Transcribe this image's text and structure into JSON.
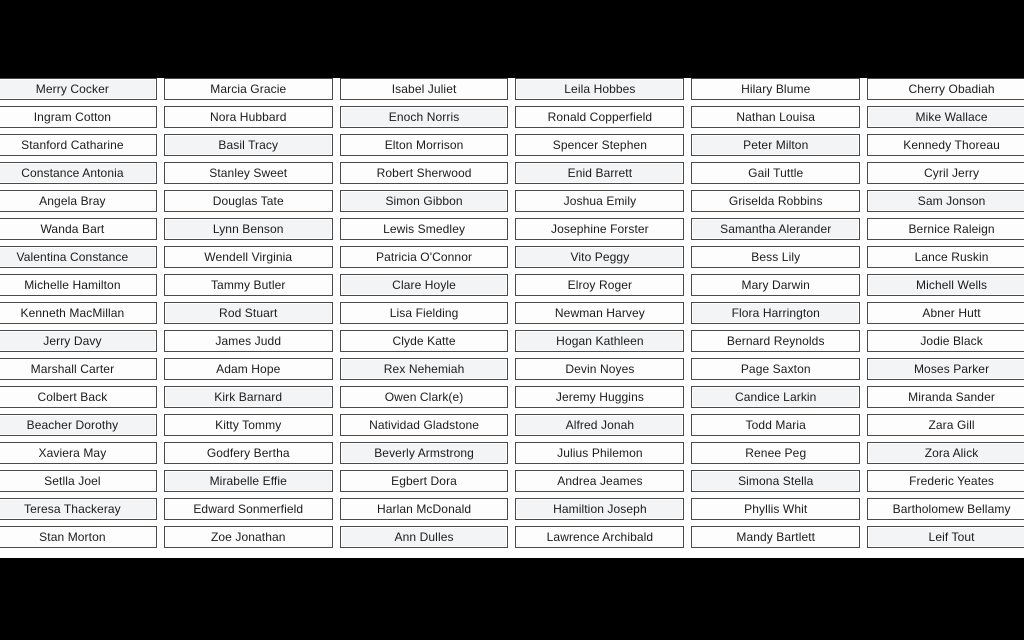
{
  "screen": {
    "background_color": "#000000",
    "content_background_color": "#ffffff",
    "cell_border_color": "#4a4a4a",
    "cell_text_color": "#1a1a1a",
    "columns": 6,
    "rows": 17
  },
  "grid": {
    "description": "Six-column grid of clickable person name buttons",
    "column_headers": [],
    "columns": [
      {
        "index": 1,
        "names": [
          "Merry Cocker",
          "Ingram Cotton",
          "Stanford Catharine",
          "Constance Antonia",
          "Angela Bray",
          "Wanda Bart",
          "Valentina Constance",
          "Michelle Hamilton",
          "Kenneth MacMillan",
          "Jerry Davy",
          "Marshall Carter",
          "Colbert Back",
          "Beacher Dorothy",
          "Xaviera May",
          "Setlla Joel",
          "Teresa Thackeray",
          "Stan Morton"
        ]
      },
      {
        "index": 2,
        "names": [
          "Marcia Gracie",
          "Nora Hubbard",
          "Basil Tracy",
          "Stanley Sweet",
          "Douglas Tate",
          "Lynn Benson",
          "Wendell Virginia",
          "Tammy Butler",
          "Rod Stuart",
          "James Judd",
          "Adam Hope",
          "Kirk Barnard",
          "Kitty Tommy",
          "Godfery Bertha",
          "Mirabelle Effie",
          "Edward Sonmerfield",
          "Zoe Jonathan"
        ]
      },
      {
        "index": 3,
        "names": [
          "Isabel Juliet",
          "Enoch Norris",
          "Elton Morrison",
          "Robert Sherwood",
          "Simon Gibbon",
          "Lewis Smedley",
          "Patricia O'Connor",
          "Clare Hoyle",
          "Lisa Fielding",
          "Clyde Katte",
          "Rex Nehemiah",
          "Owen Clark(e)",
          "Natividad Gladstone",
          "Beverly Armstrong",
          "Egbert Dora",
          "Harlan McDonald",
          "Ann Dulles"
        ]
      },
      {
        "index": 4,
        "names": [
          "Leila Hobbes",
          "Ronald Copperfield",
          "Spencer Stephen",
          "Enid Barrett",
          "Joshua Emily",
          "Josephine Forster",
          "Vito Peggy",
          "Elroy Roger",
          "Newman Harvey",
          "Hogan Kathleen",
          "Devin Noyes",
          "Jeremy Huggins",
          "Alfred Jonah",
          "Julius Philemon",
          "Andrea Jeames",
          "Hamiltion Joseph",
          "Lawrence Archibald"
        ]
      },
      {
        "index": 5,
        "names": [
          "Hilary Blume",
          "Nathan Louisa",
          "Peter Milton",
          "Gail Tuttle",
          "Griselda Robbins",
          "Samantha Alerander",
          "Bess Lily",
          "Mary Darwin",
          "Flora Harrington",
          "Bernard Reynolds",
          "Page Saxton",
          "Candice Larkin",
          "Todd Maria",
          "Renee Peg",
          "Simona Stella",
          "Phyllis Whit",
          "Mandy Bartlett"
        ]
      },
      {
        "index": 6,
        "names": [
          "Cherry Obadiah",
          "Mike Wallace",
          "Kennedy Thoreau",
          "Cyril Jerry",
          "Sam Jonson",
          "Bernice Raleign",
          "Lance Ruskin",
          "Michell Wells",
          "Abner Hutt",
          "Jodie Black",
          "Moses Parker",
          "Miranda Sander",
          "Zara Gill",
          "Zora Alick",
          "Frederic Yeates",
          "Bartholomew Bellamy",
          "Leif Tout"
        ]
      }
    ]
  }
}
